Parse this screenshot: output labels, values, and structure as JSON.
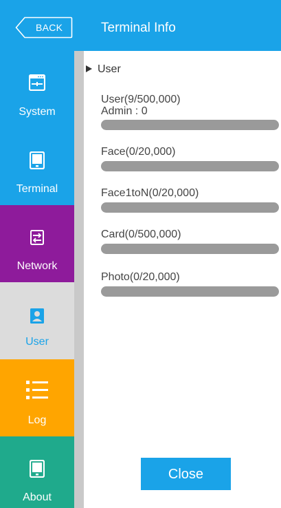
{
  "header": {
    "back_label": "BACK",
    "title": "Terminal Info"
  },
  "sidebar": {
    "items": [
      {
        "label": "System",
        "color": "#1aa3e8",
        "icon": "system-icon"
      },
      {
        "label": "Terminal",
        "color": "#1aa3e8",
        "icon": "terminal-icon"
      },
      {
        "label": "Network",
        "color": "#8e1b9b",
        "icon": "network-icon"
      },
      {
        "label": "User",
        "color": "#dcdcdc",
        "icon": "user-icon",
        "selected": true
      },
      {
        "label": "Log",
        "color": "#ffa500",
        "icon": "log-icon"
      },
      {
        "label": "About",
        "color": "#1faa8c",
        "icon": "about-icon"
      }
    ]
  },
  "content": {
    "section_title": "User",
    "stats": [
      {
        "label": "User(9/500,000)",
        "sub": "Admin : 0",
        "used": 9,
        "total": 500000
      },
      {
        "label": "Face(0/20,000)",
        "used": 0,
        "total": 20000
      },
      {
        "label": "Face1toN(0/20,000)",
        "used": 0,
        "total": 20000
      },
      {
        "label": "Card(0/500,000)",
        "used": 0,
        "total": 500000
      },
      {
        "label": "Photo(0/20,000)",
        "used": 0,
        "total": 20000
      }
    ]
  },
  "footer": {
    "close_label": "Close"
  },
  "colors": {
    "accent": "#1aa3e8",
    "bar": "#9a9a9a",
    "strip": "#c9c9c9"
  }
}
